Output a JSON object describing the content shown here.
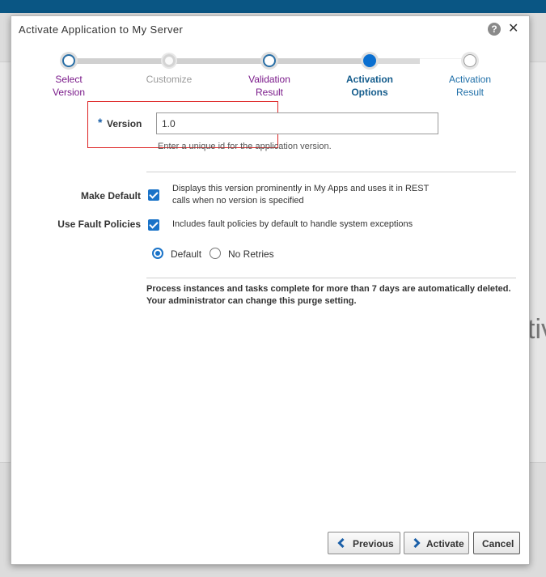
{
  "dialog": {
    "title": "Activate Application to My Server",
    "help_glyph": "?",
    "close_glyph": "✕"
  },
  "train": {
    "steps": [
      {
        "line1": "Select",
        "line2": "Version",
        "state": "visited"
      },
      {
        "line1": "Customize",
        "line2": "",
        "state": "disabled"
      },
      {
        "line1": "Validation",
        "line2": "Result",
        "state": "visited"
      },
      {
        "line1": "Activation",
        "line2": "Options",
        "state": "current"
      },
      {
        "line1": "Activation",
        "line2": "Result",
        "state": "unvisited"
      }
    ]
  },
  "version": {
    "required_marker": "*",
    "label": "Version",
    "value": "1.0",
    "hint": "Enter a unique id for the application version."
  },
  "make_default": {
    "label": "Make Default",
    "checked": true,
    "description": "Displays this version prominently in My Apps and uses it in REST calls when no version is specified"
  },
  "fault_policies": {
    "label": "Use Fault Policies",
    "checked": true,
    "description": "Includes fault policies by default to handle system exceptions"
  },
  "retry_options": {
    "selected": "Default",
    "options": [
      "Default",
      "No Retries"
    ]
  },
  "purge_notice": "Process instances and tasks complete for more than 7 days are automatically deleted. Your administrator can change this purge setting.",
  "buttons": {
    "previous": "Previous",
    "activate": "Activate",
    "cancel": "Cancel"
  },
  "background": {
    "partial_text": "tiv"
  },
  "colors": {
    "accent": "#1a73c8",
    "brand_bar": "#0a5684",
    "visited_step": "#7a1a8a",
    "error_outline": "#dd2222"
  }
}
